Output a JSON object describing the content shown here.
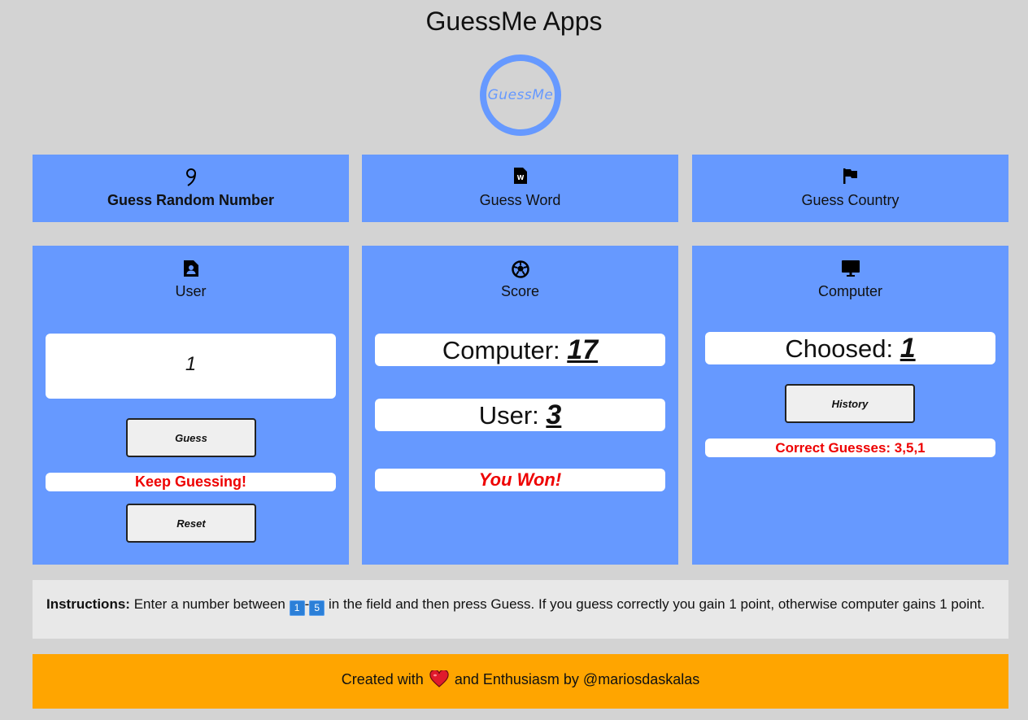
{
  "app": {
    "title": "GuessMe Apps",
    "logo_text": "GuessMe"
  },
  "tabs": [
    {
      "label": "Guess Random Number",
      "icon": "number-nine-icon",
      "active": true
    },
    {
      "label": "Guess Word",
      "icon": "word-file-icon",
      "active": false
    },
    {
      "label": "Guess Country",
      "icon": "flag-icon",
      "active": false
    }
  ],
  "user_panel": {
    "title": "User",
    "icon": "user-badge-icon",
    "input_value": "1",
    "guess_label": "Guess",
    "status": "Keep Guessing!",
    "reset_label": "Reset"
  },
  "score_panel": {
    "title": "Score",
    "icon": "soccer-ball-icon",
    "computer_label": "Computer:",
    "computer_score": "17",
    "user_label": "User:",
    "user_score": "3",
    "result": "You Won!"
  },
  "computer_panel": {
    "title": "Computer",
    "icon": "monitor-icon",
    "choosed_label": "Choosed:",
    "choosed_value": "1",
    "history_label": "History",
    "correct_guesses": "Correct Guesses: 3,5,1"
  },
  "instructions": {
    "label": "Instructions:",
    "text_before": "Enter a number between",
    "range_low": "1",
    "dash": "-",
    "range_high": "5",
    "text_after": "in the field and then press Guess. If you guess correctly you gain 1 point, otherwise computer gains 1 point."
  },
  "footer": {
    "before": "Created with",
    "after": "and Enthusiasm by @mariosdaskalas"
  },
  "colors": {
    "panel": "#6699ff",
    "background": "#d3d3d3",
    "footer": "#ffa500",
    "alert": "#ee0000"
  }
}
